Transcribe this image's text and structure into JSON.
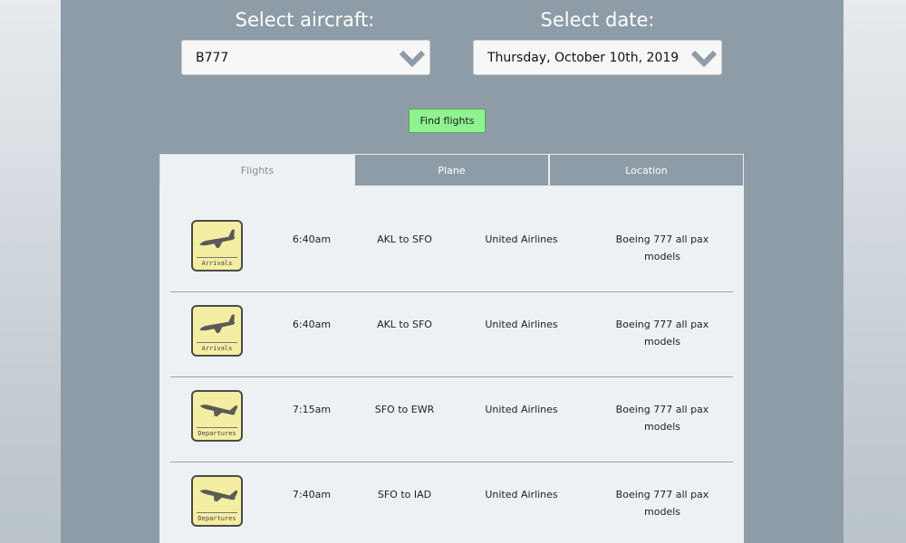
{
  "aircraft_selector": {
    "label": "Select aircraft:",
    "value": "B777"
  },
  "date_selector": {
    "label": "Select date:",
    "value": "Thursday, October 10th, 2019"
  },
  "find_button": "Find flights",
  "tabs": [
    {
      "label": "Flights",
      "active": true
    },
    {
      "label": "Plane",
      "active": false
    },
    {
      "label": "Location",
      "active": false
    }
  ],
  "flights": [
    {
      "type": "Arrivals",
      "time": "6:40am",
      "route": "AKL to SFO",
      "airline": "United Airlines",
      "model": [
        "Boeing 777 all pax",
        "models"
      ]
    },
    {
      "type": "Arrivals",
      "time": "6:40am",
      "route": "AKL to SFO",
      "airline": "United Airlines",
      "model": [
        "Boeing 777 all pax",
        "models"
      ]
    },
    {
      "type": "Departures",
      "time": "7:15am",
      "route": "SFO to EWR",
      "airline": "United Airlines",
      "model": [
        "Boeing 777 all pax",
        "models"
      ]
    },
    {
      "type": "Departures",
      "time": "7:40am",
      "route": "SFO to IAD",
      "airline": "United Airlines",
      "model": [
        "Boeing 777 all pax",
        "models"
      ]
    }
  ],
  "colors": {
    "panel": "#8e9ca8",
    "find_button": "#8ff48f",
    "badge": "#f3eea2"
  },
  "icons": {
    "arrivals": "plane-landing-icon",
    "departures": "plane-takeoff-icon",
    "dropdown": "chevron-down-icon"
  }
}
